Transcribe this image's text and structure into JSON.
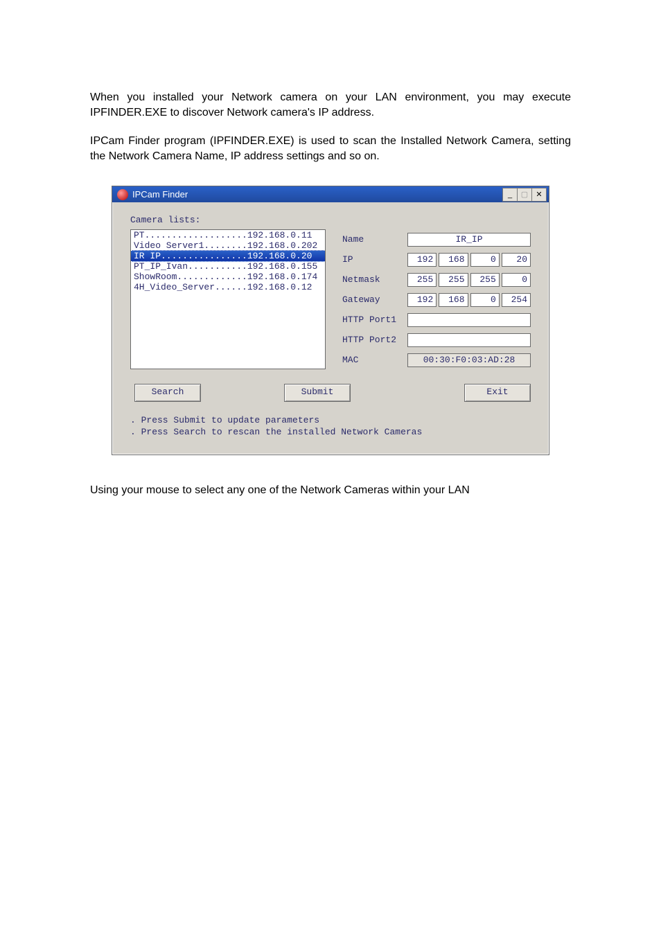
{
  "document": {
    "paragraph1": "When you installed your Network camera on your LAN environment, you may execute IPFINDER.EXE to discover Network camera's IP address.",
    "paragraph2": "IPCam Finder program (IPFINDER.EXE) is used to scan the Installed Network Camera, setting the Network Camera Name, IP address settings and so on.",
    "paragraph3": "Using your mouse to select any one of the Network Cameras within your LAN"
  },
  "window": {
    "title": "IPCam Finder",
    "icon_name": "ipcam-finder-icon",
    "buttons": {
      "minimize": "_",
      "maximize": "▢",
      "close": "✕"
    },
    "camera_lists_label": "Camera lists:",
    "list": [
      {
        "text": "PT...................192.168.0.11",
        "selected": false
      },
      {
        "text": "Video Server1........192.168.0.202",
        "selected": false
      },
      {
        "text": "IR IP................192.168.0.20",
        "selected": true
      },
      {
        "text": "PT_IP_Ivan...........192.168.0.155",
        "selected": false
      },
      {
        "text": "ShowRoom.............192.168.0.174",
        "selected": false
      },
      {
        "text": "4H_Video_Server......192.168.0.12",
        "selected": false
      }
    ],
    "form": {
      "name_label": "Name",
      "name_value": "IR_IP",
      "ip_label": "IP",
      "ip": [
        "192",
        "168",
        "0",
        "20"
      ],
      "netmask_label": "Netmask",
      "netmask": [
        "255",
        "255",
        "255",
        "0"
      ],
      "gateway_label": "Gateway",
      "gateway": [
        "192",
        "168",
        "0",
        "254"
      ],
      "http1_label": "HTTP Port1",
      "http1_value": "",
      "http2_label": "HTTP Port2",
      "http2_value": "",
      "mac_label": "MAC",
      "mac_value": "00:30:F0:03:AD:28"
    },
    "buttons_row": {
      "search": "Search",
      "submit": "Submit",
      "exit": "Exit"
    },
    "notes_line1": ". Press Submit to update parameters",
    "notes_line2": ". Press Search to rescan the installed Network Cameras"
  }
}
